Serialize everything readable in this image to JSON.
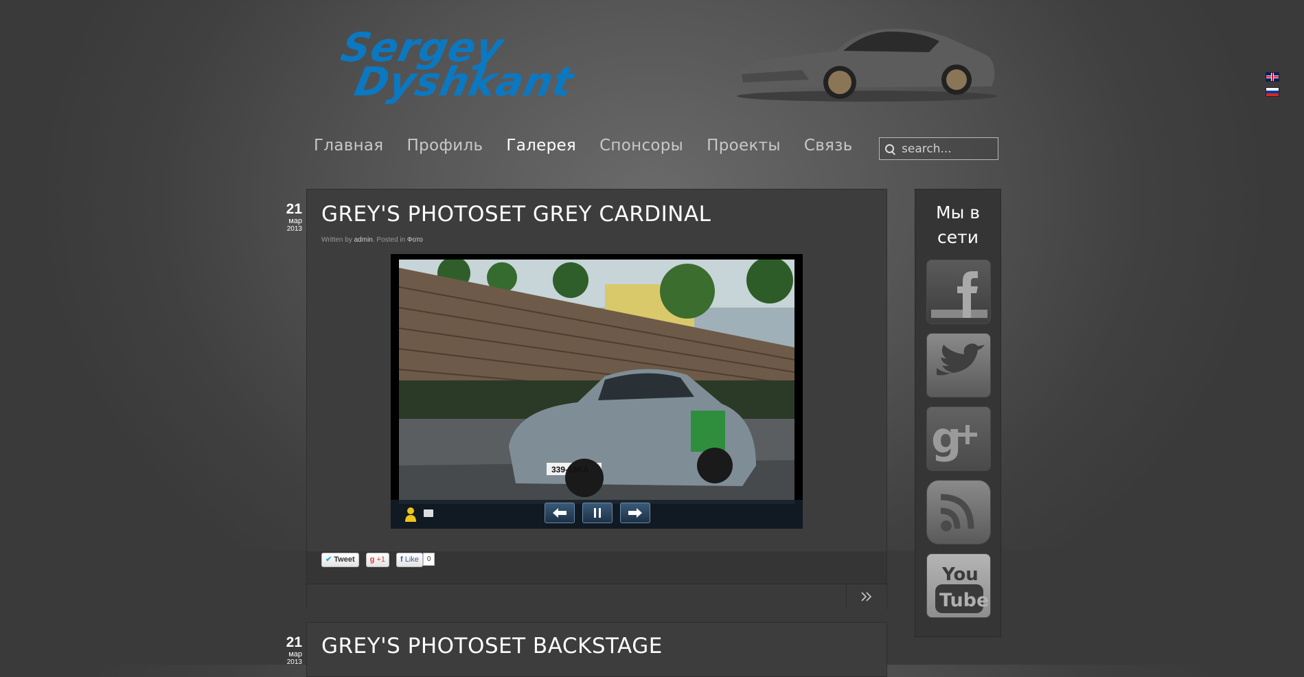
{
  "header": {
    "logo_line1": "Sergey",
    "logo_line2": "Dyshkant",
    "languages": [
      "en",
      "ru"
    ]
  },
  "nav": {
    "items": [
      "Главная",
      "Профиль",
      "Галерея",
      "Спонсоры",
      "Проекты",
      "Связь"
    ],
    "active": "Галерея"
  },
  "search": {
    "placeholder": "search..."
  },
  "posts": [
    {
      "day": "21",
      "month": "мар",
      "year": "2013",
      "title": "GREY'S PHOTOSET GREY CARDINAL",
      "meta_written_by": "Written by ",
      "meta_author": "admin",
      "meta_posted_in": ". Posted in ",
      "meta_category": "Фото",
      "plate": "339-13KA",
      "share": {
        "tweet": "Tweet",
        "gplus": "+1",
        "like": "Like",
        "like_count": "0"
      }
    },
    {
      "day": "21",
      "month": "мар",
      "year": "2013",
      "title": "GREY'S PHOTOSET BACKSTAGE"
    }
  ],
  "sidebar": {
    "title": "Мы в сети",
    "networks": [
      "facebook-icon",
      "twitter-icon",
      "google-plus-icon",
      "rss-icon",
      "youtube-icon"
    ]
  },
  "colors": {
    "logo": "#0b78c2",
    "background": "#545454",
    "panel": "#3d3d3d"
  }
}
